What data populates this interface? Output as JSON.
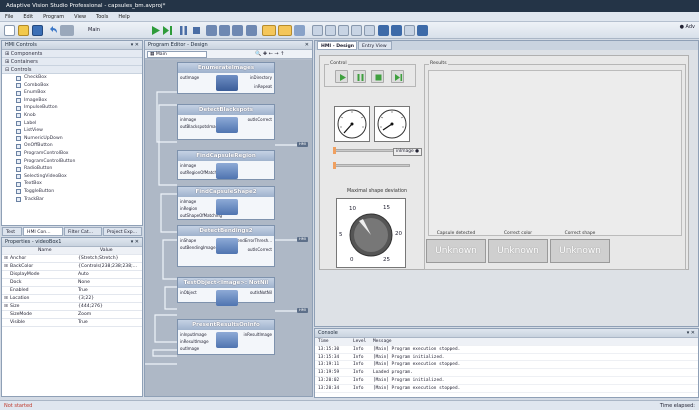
{
  "window": {
    "title": "Adaptive Vision Studio Professional - capsules_bm.avproj*",
    "user": "Adv"
  },
  "menu": [
    "File",
    "Edit",
    "Program",
    "View",
    "Tools",
    "Help"
  ],
  "toolbar": {
    "macro_label": "Main"
  },
  "hmi_controls": {
    "header": "HMI Controls",
    "categories": [
      "Components",
      "Containers",
      "Controls"
    ],
    "items": [
      "CheckBox",
      "ComboBox",
      "EnumBox",
      "ImageBox",
      "ImpulseButton",
      "Knob",
      "Label",
      "ListView",
      "NumericUpDown",
      "OnOffButton",
      "ProgramControlBox",
      "ProgramControlButton",
      "RadioButton",
      "SelectingVideoBox",
      "TextBox",
      "ToggleButton",
      "TrackBar"
    ]
  },
  "bottom_tabs": [
    "Test",
    "HMI Con...",
    "Filter Cat...",
    "Project Exp..."
  ],
  "properties": {
    "header": "Properties - videoBox1",
    "col_name": "Name",
    "col_value": "Value",
    "rows": [
      {
        "name": "Anchor",
        "value": "{Stretch;Stretch}"
      },
      {
        "name": "BackColor",
        "value": "{Controls(238;238;238;..."
      },
      {
        "name": "DisplayMode",
        "value": "Auto"
      },
      {
        "name": "Dock",
        "value": "None"
      },
      {
        "name": "Enabled",
        "value": "True"
      },
      {
        "name": "Location",
        "value": "{3;22}"
      },
      {
        "name": "Size",
        "value": "{444;276}"
      },
      {
        "name": "SizeMode",
        "value": "Zoom"
      },
      {
        "name": "Visible",
        "value": "True"
      }
    ]
  },
  "program_editor": {
    "header": "Program Editor - Design",
    "macro": "Main",
    "blocks": [
      {
        "title": "EnumerateImages",
        "inputs": [
          "outImage"
        ],
        "outputs": [
          "inDirectory",
          "inRepeat"
        ]
      },
      {
        "title": "DetectBlackspots",
        "inputs": [
          "inImage",
          "outBlackspotsImage"
        ],
        "outputs": [
          "outIsCorrect"
        ]
      },
      {
        "title": "FindCapsuleRegion",
        "inputs": [
          "inImage",
          "outRegionOfMatching"
        ],
        "outputs": []
      },
      {
        "title": "FindCapsuleShape2",
        "inputs": [
          "inImage",
          "inRegion",
          "outShapeOfMatching"
        ],
        "outputs": []
      },
      {
        "title": "DetectBendings2",
        "inputs": [
          "inShape",
          "outBendingImage"
        ],
        "outputs": [
          "inBendErrorThresh...",
          "outIsCorrect"
        ]
      },
      {
        "title": "TestObject<Image>: NotNil",
        "inputs": [
          "inObject"
        ],
        "outputs": [
          "outIsNotNil"
        ]
      },
      {
        "title": "PresentResultsOnInfo",
        "inputs": [
          "inInputImage",
          "inResultImage",
          "outImage"
        ],
        "outputs": [
          "inResultImage"
        ]
      }
    ],
    "port_tag": "HMI"
  },
  "hmi_design": {
    "tabs": [
      "HMI - Design",
      "Entry View"
    ],
    "control_label": "Control",
    "results_label": "Results",
    "image_port": "inImage",
    "knob_title": "Maximal shape deviation",
    "knob_ticks": [
      "0",
      "5",
      "10",
      "15",
      "20",
      "25"
    ],
    "result_labels": [
      "Capsule detected",
      "Correct color",
      "Correct shape"
    ],
    "result_values": [
      "Unknown",
      "Unknown",
      "Unknown"
    ]
  },
  "console": {
    "header": "Console",
    "columns": [
      "Time",
      "Level",
      "Message"
    ],
    "rows": [
      {
        "time": "13:15:30",
        "level": "Info",
        "message": "[Main] Program execution stopped."
      },
      {
        "time": "13:15:34",
        "level": "Info",
        "message": "[Main] Program initialized."
      },
      {
        "time": "13:19:11",
        "level": "Info",
        "message": "[Main] Program execution stopped."
      },
      {
        "time": "13:19:59",
        "level": "Info",
        "message": "Loaded program."
      },
      {
        "time": "13:20:02",
        "level": "Info",
        "message": "[Main] Program initialized."
      },
      {
        "time": "13:20:34",
        "level": "Info",
        "message": "[Main] Program execution stopped."
      }
    ]
  },
  "status": {
    "left": "Not started",
    "right": "Time elapsed:"
  }
}
